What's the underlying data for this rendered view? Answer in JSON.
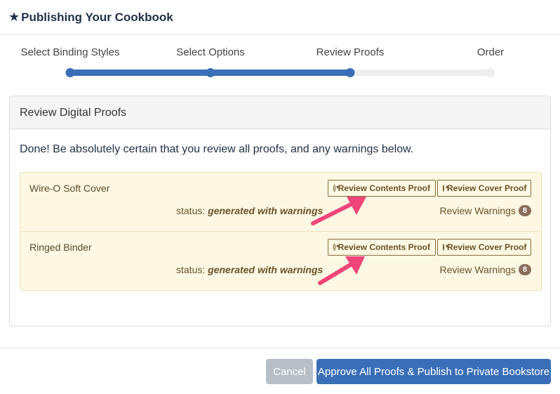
{
  "modal": {
    "title": "Publishing Your Cookbook",
    "title_icon": "star-icon"
  },
  "steps": [
    {
      "label": "Select Binding Styles",
      "complete": true
    },
    {
      "label": "Select Options",
      "complete": true
    },
    {
      "label": "Review Proofs",
      "complete": true
    },
    {
      "label": "Order",
      "complete": false
    }
  ],
  "panel": {
    "heading": "Review Digital Proofs",
    "intro": "Done! Be absolutely certain that you review all proofs, and any warnings below."
  },
  "proofs": [
    {
      "name": "Wire-O Soft Cover",
      "contents_button": "Review Contents Proof",
      "cover_button": "Review Cover Proof",
      "status_label": "status:",
      "status_value": "generated with warnings",
      "warnings_label": "Review Warnings",
      "warnings_count": "8"
    },
    {
      "name": "Ringed Binder",
      "contents_button": "Review Contents Proof",
      "cover_button": "Review Cover Proof",
      "status_label": "status:",
      "status_value": "generated with warnings",
      "warnings_label": "Review Warnings",
      "warnings_count": "8"
    }
  ],
  "footer": {
    "cancel_label": "Cancel",
    "approve_label": "Approve All Proofs & Publish to Private Bookstore"
  },
  "colors": {
    "primary": "#3a6fb7",
    "warning_bg": "#fcf8e3",
    "annotation_arrow": "#f0457a"
  }
}
